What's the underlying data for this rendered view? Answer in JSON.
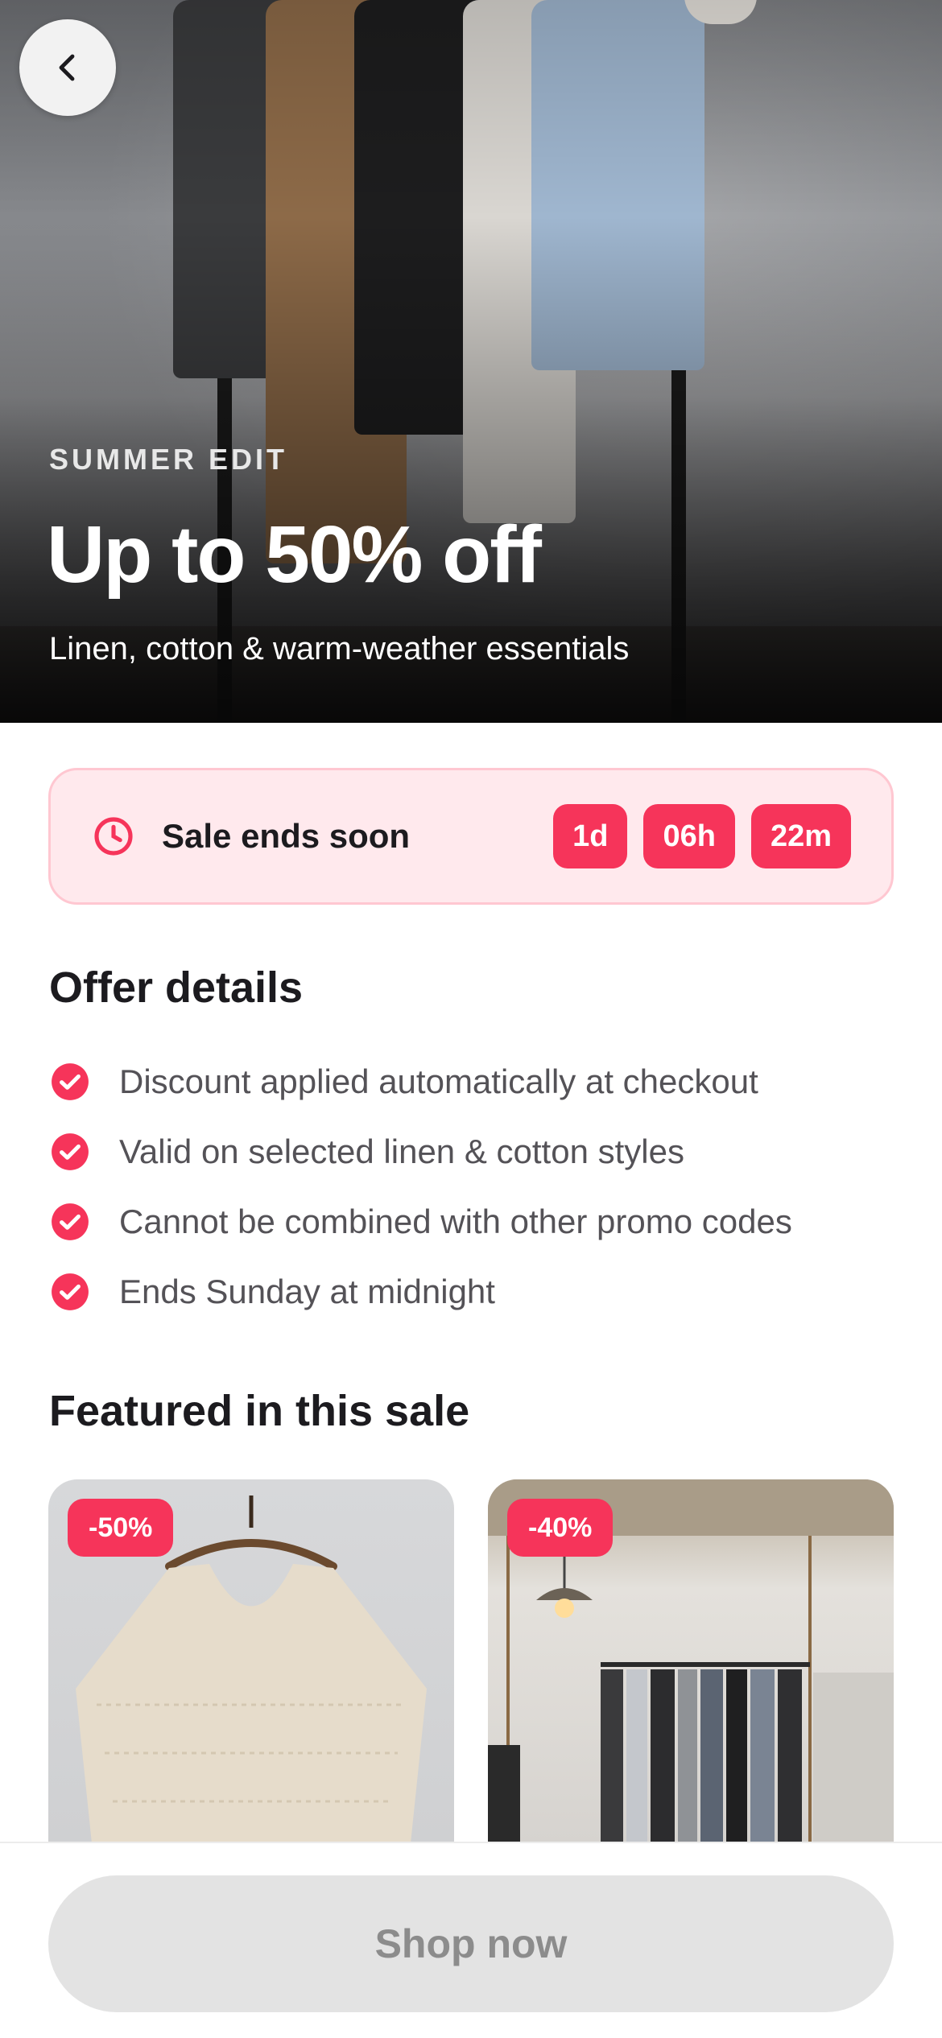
{
  "hero": {
    "eyebrow": "SUMMER EDIT",
    "title": "Up to 50% off",
    "subtitle": "Linen, cotton & warm-weather essentials"
  },
  "back_icon": "chevron-left-icon",
  "countdown": {
    "icon": "clock-icon",
    "label": "Sale ends soon",
    "days": "1d",
    "hours": "06h",
    "minutes": "22m"
  },
  "offer_details": {
    "title": "Offer details",
    "items": [
      "Discount applied automatically at checkout",
      "Valid on selected linen & cotton styles",
      "Cannot be combined with other promo codes",
      "Ends Sunday at midnight"
    ]
  },
  "featured": {
    "title": "Featured in this sale",
    "cards": [
      {
        "badge": "-50%"
      },
      {
        "badge": "-40%"
      }
    ]
  },
  "cta": {
    "label": "Shop now"
  },
  "colors": {
    "accent": "#f6345a",
    "countdown_bg": "#ffe9ed",
    "countdown_border": "#ffc7d1",
    "cta_disabled_bg": "#e3e3e3",
    "cta_disabled_text": "#8c8c8c"
  }
}
